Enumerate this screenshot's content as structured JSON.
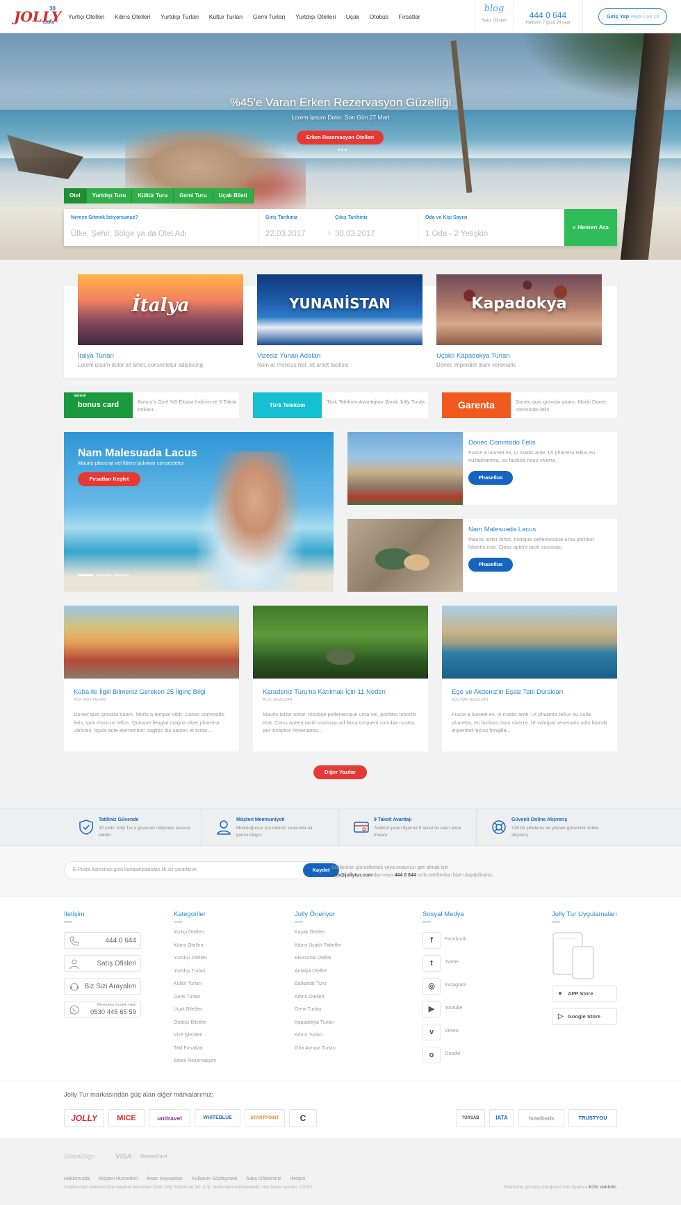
{
  "header": {
    "logo_text": "JOLLY",
    "logo_badge": "30",
    "logo_sub": "TOURS",
    "nav": [
      "Yurtiçi Otelleri",
      "Kıbrıs Otelleri",
      "Yurtdışı Turları",
      "Kültür Turları",
      "Gemi Turları",
      "Yurtdışı Otelleri",
      "Uçak",
      "Otobüs",
      "Fırsatlar"
    ],
    "blog_label": "blog",
    "blog_sub": "Satış Ofisleri",
    "phone": "444 0 644",
    "phone_sub": "Haftanın 7 günü 24 saat",
    "login_bold": "Giriş Yap",
    "login_light": "veya Üye Ol"
  },
  "hero": {
    "title": "%45'e Varan Erken Rezervasyon Güzelliği",
    "subtitle": "Lorem Ipsum Dolor. Son Gün 27 Mart",
    "button": "Erken Rezervasyon Otelleri"
  },
  "search": {
    "tabs": [
      "Otel",
      "Yurtdışı Turu",
      "Kültür Turu",
      "Gemi Turu",
      "Uçak Bileti"
    ],
    "destination_label": "Nereye Gitmek İstiyorsunuz?",
    "destination_placeholder": "Ülke, Şehir, Bölge ya da Otel Adı",
    "checkin_label": "Giriş Tarihiniz",
    "checkin_value": "22.03.2017",
    "checkout_label": "Çıkış Tarihiniz",
    "checkout_value": "30.03.2017",
    "guests_label": "Oda ve Kişi Sayısı",
    "guests_value": "1 Oda - 2 Yetişkin",
    "button": "Hemen Ara"
  },
  "destinations": [
    {
      "word": "İtalya",
      "title": "İtalya Turları",
      "desc": "Lorem ipsum dolor sit amet, consectetur adipiscing"
    },
    {
      "word": "YUNANİSTAN",
      "title": "Vizesiz Yunan Adaları",
      "desc": "Nam at rhoncus nisl, sit amet facilisis"
    },
    {
      "word": "Kapadokya",
      "title": "Uçaklı Kapadokya Turları",
      "desc": "Donec imperdiet diam venenatis"
    }
  ],
  "partners": [
    {
      "logo": "bonus card",
      "logo_small": "Garanti",
      "text": "Bonus'a Özel %5 Ekstra İndirim ve 9 Taksit İmkanı",
      "color": "#1a9a3c"
    },
    {
      "logo": "Türk Telekom",
      "text": "Türk Telekom Avantajları Şimdi Jolly Turda",
      "color": "#15c0d0"
    },
    {
      "logo": "Garenta",
      "text": "Donec quis gravida quam. Morbi Donec commodo felis",
      "color": "#f05a1e"
    }
  ],
  "promo": {
    "big_title": "Nam Malesuada Lacus",
    "big_sub": "Mauris placerat vel libero pulvinar consectetur",
    "big_button": "Fırsatları Keşfet",
    "small": [
      {
        "title": "Donec Commodo Felis",
        "desc": "Fusce a laoreet ex, in mattis ante. Ut pharetra tellus eu nullapharetra, eu facilisis risus viverra.",
        "button": "Phasellus"
      },
      {
        "title": "Nam Malesuada Lacus",
        "desc": "Mauris tortor tortor, tristique pellentesque urna porttitor lobortis erat. Class aptent taciti sociosqu",
        "button": "Phasellus"
      }
    ]
  },
  "blog": [
    {
      "title": "Küba ile İlgili Bilmeniz Gereken 25 İlginç Bilgi",
      "category": "PÜF NOKTALARI",
      "desc": "Donec quis gravida quam. Morbi a tempor nibh. Donec commodo felis, quis rhoncus tellus. Quisque feugiat magna vitae pharetra ultricies, ligula ante elementum sagittis dui sapien et tortor..."
    },
    {
      "title": "Karadeniz Turu'na Katılmak İçin 11 Neden",
      "category": "AİLE GEZİLERİ",
      "desc": "Mauris tortor tortor, tristique pellentesque urna vel, porttitor lobortis erat. Class aptent taciti sociosqu ad litora torquent conubia nostra, per inceptos himenaeos..."
    },
    {
      "title": "Ege ve Akdeniz'in Eşsiz Tatil Durakları",
      "category": "KÜLTÜR GEZİLERİ",
      "desc": "Fusce a laoreet ex, in mattis ante. Ut pharetra tellus eu nulla pharetra, eu facilisis risus viverra. Ut volutpat venenatis odio blandit imperdiet lectus fringilla..."
    }
  ],
  "more_button": "Diğer Yazılar",
  "features": [
    {
      "title": "Tatiliniz Güvende",
      "desc": "30 yıldır Jolly Tur'a güvenen milyonlar arasına katılın",
      "icon": "shield-icon"
    },
    {
      "title": "Müşteri Memnuniyeti",
      "desc": "Mutluluğunuz için tatiliniz sırasında da yanınızdayız",
      "icon": "person-icon"
    },
    {
      "title": "9 Taksit Avantajı",
      "desc": "Tatilinizi peşin fiyatına 9 taksit ile satın alma imkanı",
      "icon": "card-icon"
    },
    {
      "title": "Güvenli Online Alışveriş",
      "desc": "128 bit şifreleme ile yüksek güvenlikli online alışveriş",
      "icon": "lifebuoy-icon"
    }
  ],
  "newsletter": {
    "placeholder": "E-Posta Adresinizi girin kampanyalardan ilk siz yararlanın",
    "button": "Kaydet",
    "info_1": "Bilgilerinizi güncellemek veya onayınızı geri almak için",
    "info_email": "info@jollytur.com",
    "info_2": "'dan veya",
    "info_phone": "444 0 644",
    "info_3": "no'lu telefondan bize ulaşabilirsiniz."
  },
  "footer": {
    "contact_title": "İletişim",
    "contact_phone": "444 0 644",
    "contact_offices": "Satış Ofisleri",
    "contact_callback": "Biz Sizi Arayalım",
    "whatsapp_label": "WhatsApp Destek Hattı",
    "whatsapp_number": "0530 445 65 59",
    "categories_title": "Kategoriler",
    "categories": [
      "Yurtiçi Otelleri",
      "Kıbrıs Otelleri",
      "Yurtdışı Otelleri",
      "Yurtdışı Turları",
      "Kültür Turları",
      "Gemi Turları",
      "Uçak Biletleri",
      "Otobüs Biletleri",
      "Vize İşlemleri",
      "Tatil Fırsatları",
      "Erken Rezervasyon"
    ],
    "recommends_title": "Jolly Öneriyor",
    "recommends": [
      "Kayak Otelleri",
      "Kıbrıs Uçaklı Paketler",
      "Ekonomik Oteller",
      "Antalya Otelleri",
      "Balkanlar Turu",
      "Kıbrıs Otelleri",
      "Gemi Turları",
      "Kapadokya Turları",
      "Kıbrıs Turları",
      "Orta Avrupa Turları"
    ],
    "social_title": "Sosyal Medya",
    "social": [
      {
        "name": "Facebook",
        "glyph": "f"
      },
      {
        "name": "Twitter",
        "glyph": "t"
      },
      {
        "name": "Instagram",
        "glyph": "◎"
      },
      {
        "name": "Youtube",
        "glyph": "▶"
      },
      {
        "name": "Vimeo",
        "glyph": "v"
      },
      {
        "name": "Onedio",
        "glyph": "o"
      }
    ],
    "apps_title": "Jolly Tur Uygulamaları",
    "app_store": "APP Store",
    "google_store": "Google Store"
  },
  "brands": {
    "title": "Jolly Tur markasından güç alan diğer markalarımız;",
    "left": [
      {
        "name": "JOLLY",
        "color": "#d42b2b"
      },
      {
        "name": "MICE",
        "color": "#d42b2b"
      },
      {
        "name": "unitravel",
        "color": "#7b2d8e"
      },
      {
        "name": "WHITEBLUE",
        "color": "#2a6fc0"
      },
      {
        "name": "STARTPOINT",
        "color": "#e08a1e"
      },
      {
        "name": "C",
        "color": "#1d3f8f"
      }
    ],
    "right": [
      {
        "name": "TÜRSAB",
        "color": "#555555"
      },
      {
        "name": "IATA",
        "color": "#1e6fb5"
      },
      {
        "name": "hotelbeds",
        "color": "#888888"
      },
      {
        "name": "TRUSTYOU",
        "color": "#1d5fa8"
      }
    ]
  },
  "bottom": {
    "payments": [
      "GlobalSign",
      "VISA",
      "MasterCard"
    ],
    "links": [
      "Hakkımızda",
      "Müşteri Hizmetleri",
      "İnsan Kaynakları",
      "Kullanım Sözleşmesi",
      "Satış Ofislerimiz",
      "İletişim"
    ],
    "copyright": "Jollytur.com sitesinin tüm seyahat hizmetleri Club Jolly Turizm ve Tic. A.Ş. tarafından verilmektedir. Her hakkı saklıdır. ©2017",
    "vat_text": "Sitemizde görmüş olduğunuz tüm fiyatlara",
    "vat_bold": "KDV dahildir."
  }
}
